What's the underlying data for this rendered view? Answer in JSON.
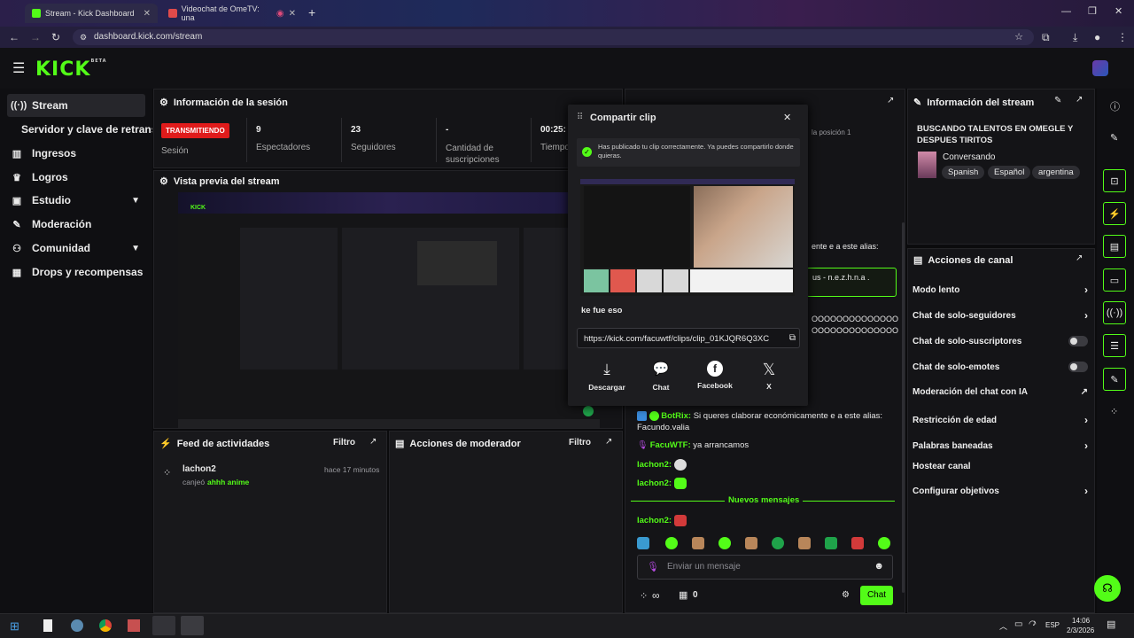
{
  "browser": {
    "tabs": [
      {
        "label": "Stream - Kick Dashboard"
      },
      {
        "label": "Videochat de OmeTV: una"
      }
    ],
    "url": "dashboard.kick.com/stream"
  },
  "app": {
    "logo": "KICK",
    "logo_sup": "BETA",
    "brand_color": "#53fc18"
  },
  "sidebar": {
    "items": [
      {
        "label": "Stream",
        "icon": "broadcast-icon"
      },
      {
        "label": "Servidor y clave de retransm",
        "icon": ""
      },
      {
        "label": "Ingresos",
        "icon": "chart-icon"
      },
      {
        "label": "Logros",
        "icon": "trophy-icon"
      },
      {
        "label": "Estudio",
        "icon": "studio-icon"
      },
      {
        "label": "Moderación",
        "icon": "wrench-icon"
      },
      {
        "label": "Comunidad",
        "icon": "people-icon"
      },
      {
        "label": "Drops y recompensas",
        "icon": "gift-icon"
      }
    ]
  },
  "session": {
    "title": "Información de la sesión",
    "status": "TRANSMITIENDO",
    "status_label": "Sesión",
    "stats": [
      {
        "value": "9",
        "label": "Espectadores"
      },
      {
        "value": "23",
        "label": "Seguidores"
      },
      {
        "value": "-",
        "label": "Cantidad de suscripciones"
      },
      {
        "value": "00:25:",
        "label": "Tiempo"
      }
    ]
  },
  "preview": {
    "title": "Vista previa del stream"
  },
  "feed": {
    "title": "Feed de actividades",
    "filter": "Filtro",
    "items": [
      {
        "user": "lachon2",
        "time": "hace 17 minutos",
        "action": "canjeó",
        "reward": "ahhh anime"
      }
    ]
  },
  "mod_actions": {
    "title": "Acciones de moderador",
    "filter": "Filtro"
  },
  "chat_panel": {
    "partial_1": "la posición 1",
    "partial_2": "ente e a este alias:",
    "partial_3": "us - n.e.z.h.n.a .",
    "partial_4": "OOOOOOOOOOOOOO",
    "partial_5": "OOOOOOOOOOOOOO",
    "messages": [
      {
        "user": "BotRix:",
        "text": "Si queres claborar económicamente e a este alias: Facundo.valia"
      },
      {
        "user": "FacuWTF:",
        "text": "ya arrancamos"
      },
      {
        "user": "lachon2:",
        "text": ""
      },
      {
        "user": "lachon2:",
        "text": ""
      }
    ],
    "new_messages": "Nuevos mensajes",
    "last_user": "lachon2:",
    "input_placeholder": "Enviar un mensaje",
    "points": "∞",
    "gifts": "0",
    "send_label": "Chat"
  },
  "modal": {
    "title": "Compartir clip",
    "success": "Has publicado tu clip correctamente. Ya puedes compartirlo donde quieras.",
    "clip_title": "ke fue eso",
    "clip_url": "https://kick.com/facuwtf/clips/clip_01KJQR6Q3XC",
    "share": [
      {
        "label": "Descargar",
        "icon": "download-icon"
      },
      {
        "label": "Chat",
        "icon": "chat-bubble-icon"
      },
      {
        "label": "Facebook",
        "icon": "facebook-icon"
      },
      {
        "label": "X",
        "icon": "x-logo-icon"
      }
    ]
  },
  "stream_info": {
    "title": "Información del stream",
    "stream_title": "BUSCANDO TALENTOS EN OMEGLE Y DESPUES TIRITOS",
    "category": "Conversando",
    "tags": [
      "Spanish",
      "Español",
      "argentina"
    ]
  },
  "channel_actions": {
    "title": "Acciones de canal",
    "items": [
      {
        "label": "Modo lento",
        "control": "chevron"
      },
      {
        "label": "Chat de solo-seguidores",
        "control": "chevron"
      },
      {
        "label": "Chat de solo-suscriptores",
        "control": "toggle"
      },
      {
        "label": "Chat de solo-emotes",
        "control": "toggle"
      },
      {
        "label": "Moderación del chat con IA",
        "control": "external"
      },
      {
        "label": "Restricción de edad",
        "control": "chevron"
      },
      {
        "label": "Palabras baneadas",
        "control": "chevron"
      },
      {
        "label": "Hostear canal",
        "control": "none"
      },
      {
        "label": "Configurar objetivos",
        "control": "chevron"
      }
    ]
  },
  "taskbar": {
    "lang": "ESP",
    "time": "14:06",
    "date": "2/3/2026"
  }
}
